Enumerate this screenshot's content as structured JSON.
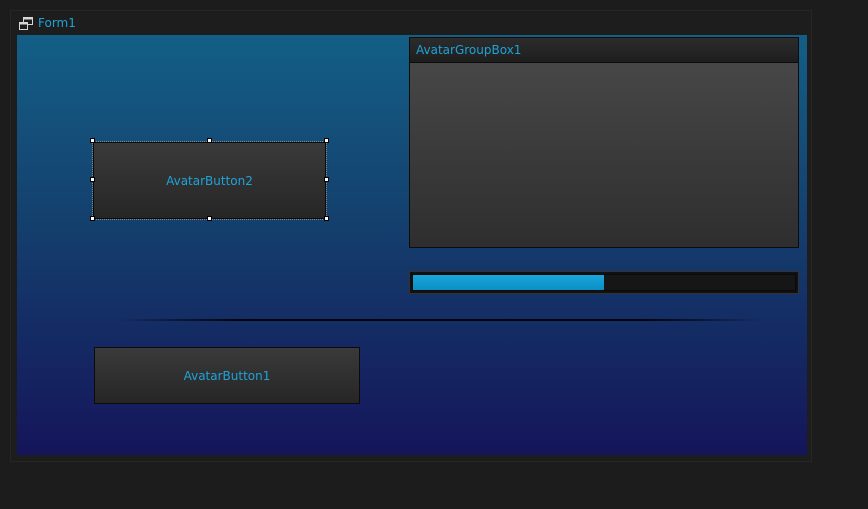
{
  "window": {
    "title": "Form1",
    "icon": "form-window-icon"
  },
  "groupbox": {
    "title": "AvatarGroupBox1"
  },
  "buttons": {
    "button2_label": "AvatarButton2",
    "button1_label": "AvatarButton1"
  },
  "progress": {
    "value_fraction": 0.5
  },
  "colors": {
    "accent_text": "#1ea3d7",
    "progress_fill": "#0a97cf",
    "gradient_top": "#135f86",
    "gradient_bottom": "#15155a"
  }
}
